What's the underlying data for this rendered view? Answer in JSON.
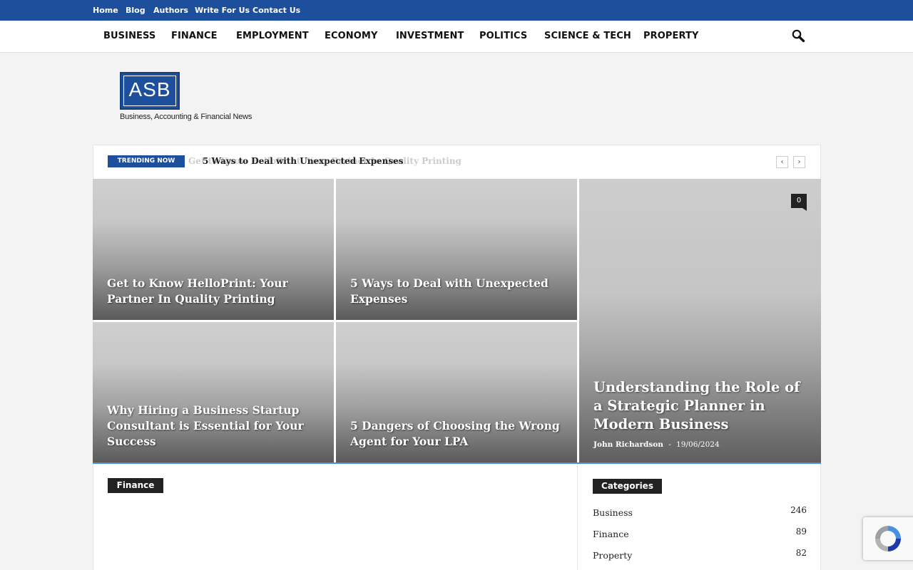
{
  "top_nav": [
    "Home",
    "Blog",
    "Authors",
    "Write For Us",
    "Contact Us"
  ],
  "main_menu": [
    "BUSINESS",
    "FINANCE",
    "EMPLOYMENT",
    "ECONOMY",
    "INVESTMENT",
    "POLITICS",
    "SCIENCE & TECH",
    "PROPERTY"
  ],
  "search": {
    "icon": "search-icon"
  },
  "logo": {
    "text": "ASB",
    "tagline": "Business, Accounting & Financial News"
  },
  "trending": {
    "label": "TRENDING NOW",
    "current": "5 Ways to Deal with Unexpected Expenses",
    "previous": "Get to Know HelloPrint: Your Partner In Quality Printing",
    "prev_label": "‹",
    "next_label": "›"
  },
  "featured": [
    {
      "title": "Get to Know HelloPrint: Your Partner In Quality Printing"
    },
    {
      "title": "5 Ways to Deal with Unexpected Expenses"
    },
    {
      "title": "Why Hiring a Business Startup Consultant is Essential for Your Success"
    },
    {
      "title": "5 Dangers of Choosing the Wrong Agent for Your LPA"
    },
    {
      "title": "Understanding the Role of a Strategic Planner in Modern Business",
      "author": "John Richardson",
      "separator": "-",
      "date": "19/06/2024",
      "comments": "0"
    }
  ],
  "sections": {
    "finance_label": "Finance"
  },
  "sidebar": {
    "categories_title": "Categories",
    "categories": [
      {
        "name": "Business",
        "count": "246"
      },
      {
        "name": "Finance",
        "count": "89"
      },
      {
        "name": "Property",
        "count": "82"
      }
    ]
  },
  "colors": {
    "brand_blue": "#1d4f9c",
    "dark_label": "#222222",
    "accent_line": "#4a90d6"
  }
}
